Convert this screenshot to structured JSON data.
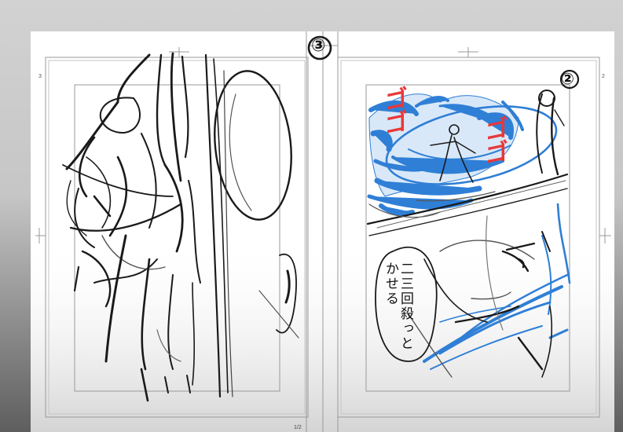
{
  "spread": {
    "left_page": {
      "page_number": "3",
      "hand_number": "③"
    },
    "right_page": {
      "page_number": "2",
      "hand_number": "②"
    },
    "center_mark": "1/2"
  },
  "sketch": {
    "speech_text": "二三回殺っとかせる",
    "sfx_1": "ゴゴ",
    "sfx_2": "ゴゴ",
    "ink_colors": {
      "line": "#1a1a1a",
      "blue": "#2f7fd6",
      "red": "#e8383a"
    }
  }
}
